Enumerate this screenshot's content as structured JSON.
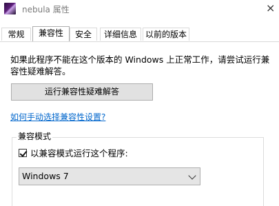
{
  "window": {
    "title": "nebula 属性",
    "close_glyph": "×"
  },
  "tabs": [
    {
      "label": "常规",
      "active": false
    },
    {
      "label": "兼容性",
      "active": true
    },
    {
      "label": "安全",
      "active": false
    },
    {
      "label": "详细信息",
      "active": false
    },
    {
      "label": "以前的版本",
      "active": false
    }
  ],
  "compat": {
    "description": "如果此程序不能在这个版本的 Windows 上正常工作，请尝试运行兼容性疑难解答。",
    "troubleshoot_button": "运行兼容性疑难解答",
    "manual_link": "如何手动选择兼容性设置?",
    "mode_group_title": "兼容模式",
    "run_in_mode_label": "以兼容模式运行这个程序:",
    "run_in_mode_checked": true,
    "selected_os": "Windows 7"
  },
  "colors": {
    "link": "#0066cc",
    "button_bg": "#e1e1e1",
    "title_text": "#7a7a7a"
  }
}
